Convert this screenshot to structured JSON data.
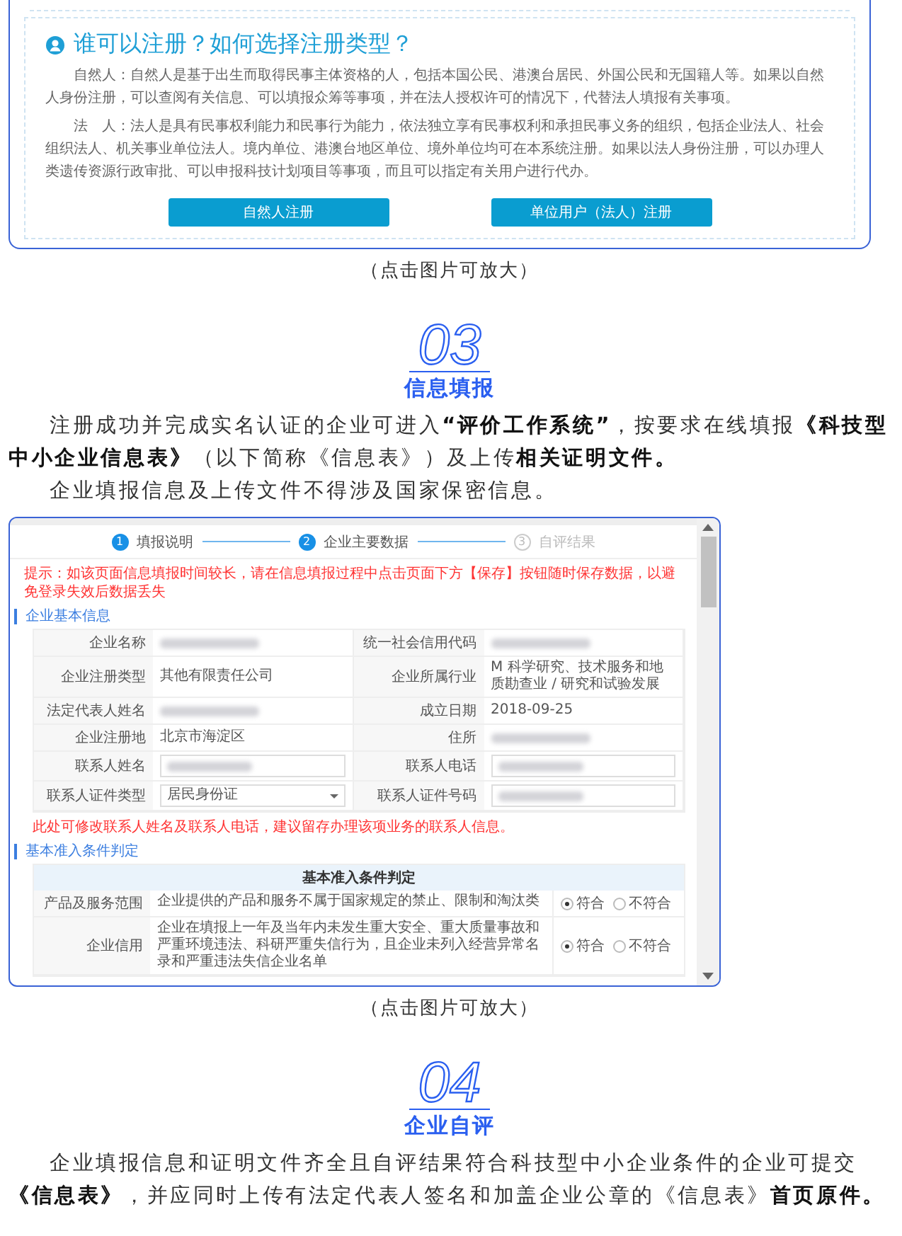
{
  "blocks": [
    {
      "kind": "card",
      "title": "谁可以注册？如何选择注册类型？",
      "paragraphs": [
        "自然人：自然人是基于出生而取得民事主体资格的人，包括本国公民、港澳台居民、外国公民和无国籍人等。如果以自然人身份注册，可以查阅有关信息、可以填报众筹等事项，并在法人授权许可的情况下，代替法人填报有关事项。",
        "法　人：法人是具有民事权利能力和民事行为能力，依法独立享有民事权利和承担民事义务的组织，包括企业法人、社会组织法人、机关事业单位法人。境内单位、港澳台地区单位、境外单位均可在本系统注册。如果以法人身份注册，可以办理人类遗传资源行政审批、可以申报科技计划项目等事项，而且可以指定有关用户进行代办。"
      ],
      "buttons": [
        "自然人注册",
        "单位用户（法人）注册"
      ]
    },
    {
      "kind": "caption",
      "text": "（点击图片可放大）"
    },
    {
      "kind": "heading",
      "number": "03",
      "title": "信息填报"
    },
    {
      "kind": "paragraph",
      "text": "注册成功并完成实名认证的企业可进入**“评价工作系统”**，按要求在线填报**《科技型中小企业信息表》**（以下简称《信息表》）及上传**相关证明文件。**"
    },
    {
      "kind": "paragraph",
      "text": "企业填报信息及上传文件不得涉及国家保密信息。"
    },
    {
      "kind": "screenshot",
      "steps": [
        {
          "number": "1",
          "label": "填报说明",
          "active": true
        },
        {
          "number": "2",
          "label": "企业主要数据",
          "active": true
        },
        {
          "number": "3",
          "label": "自评结果",
          "active": false
        }
      ],
      "notice": "提示：如该页面信息填报时间较长，请在信息填报过程中点击页面下方【保存】按钮随时保存数据，以避免登录失效后数据丢失",
      "basic_title": "企业基本信息",
      "rows": [
        [
          {
            "label": "企业名称",
            "kind": "redacted"
          },
          {
            "label": "统一社会信用代码",
            "kind": "redacted"
          }
        ],
        [
          {
            "label": "企业注册类型",
            "kind": "text",
            "value": "其他有限责任公司"
          },
          {
            "label": "企业所属行业",
            "kind": "text",
            "value": "M 科学研究、技术服务和地质勘查业 / 研究和试验发展"
          }
        ],
        [
          {
            "label": "法定代表人姓名",
            "kind": "redacted"
          },
          {
            "label": "成立日期",
            "kind": "text",
            "value": "2018-09-25"
          }
        ],
        [
          {
            "label": "企业注册地",
            "kind": "text",
            "value": "北京市海淀区"
          },
          {
            "label": "住所",
            "kind": "redacted"
          }
        ],
        [
          {
            "label": "联系人姓名",
            "kind": "input"
          },
          {
            "label": "联系人电话",
            "kind": "input"
          }
        ],
        [
          {
            "label": "联系人证件类型",
            "kind": "select",
            "value": "居民身份证"
          },
          {
            "label": "联系人证件号码",
            "kind": "input"
          }
        ]
      ],
      "note": "此处可修改联系人姓名及联系人电话，建议留存办理该项业务的联系人信息。",
      "criteria_title": "基本准入条件判定",
      "criteria_table_title": "基本准入条件判定",
      "criteria": [
        {
          "label": "产品及服务范围",
          "text": "企业提供的产品和服务不属于国家规定的禁止、限制和淘汰类",
          "choices": [
            {
              "label": "符合",
              "selected": true
            },
            {
              "label": "不符合",
              "selected": false
            }
          ]
        },
        {
          "label": "企业信用",
          "text": "企业在填报上一年及当年内未发生重大安全、重大质量事故和严重环境违法、科研严重失信行为，且企业未列入经营异常名录和严重违法失信企业名单",
          "choices": [
            {
              "label": "符合",
              "selected": true
            },
            {
              "label": "不符合",
              "selected": false
            }
          ]
        }
      ]
    },
    {
      "kind": "caption",
      "text": "（点击图片可放大）"
    },
    {
      "kind": "heading",
      "number": "04",
      "title": "企业自评"
    },
    {
      "kind": "paragraph",
      "text": "企业填报信息和证明文件齐全且自评结果符合科技型中小企业条件的企业可提交**《信息表》**，并应同时上传有法定代表人签名和加盖企业公章的《信息表》**首页原件。**"
    }
  ]
}
